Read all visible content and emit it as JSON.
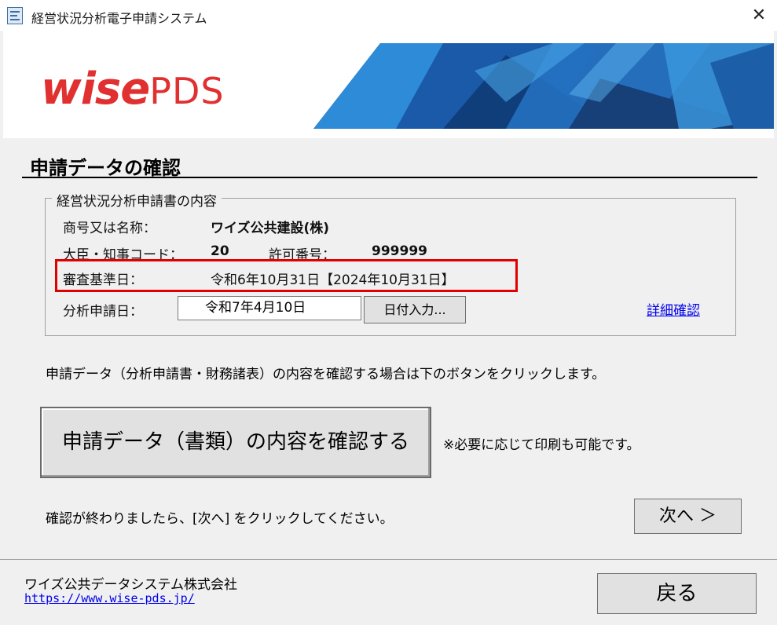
{
  "window": {
    "title": "経営状況分析電子申請システム",
    "close_glyph": "✕"
  },
  "banner": {
    "logo_wise": "wise",
    "logo_pds": "PDS",
    "logo_color": "#e03030"
  },
  "section": {
    "title": "申請データの確認"
  },
  "group": {
    "legend": "経営状況分析申請書の内容",
    "company_label": "商号又は名称：",
    "company_value": "ワイズ公共建設(株)",
    "code_label": "大臣・知事コード：",
    "code_value": "20",
    "permit_label": "許可番号：",
    "permit_value": "999999",
    "review_date_label": "審査基準日：",
    "review_date_value": "令和6年10月31日【2024年10月31日】",
    "apply_date_label": "分析申請日：",
    "apply_date_value": "令和7年4月10日",
    "date_input_button": "日付入力...",
    "detail_link": "詳細確認",
    "highlight_color": "#e00000"
  },
  "main": {
    "instruction": "申請データ（分析申請書・財務諸表）の内容を確認する場合は下のボタンをクリックします。",
    "confirm_button": "申請データ（書類）の内容を確認する",
    "print_note": "※必要に応じて印刷も可能です。",
    "next_instruction": "確認が終わりましたら、[次へ] をクリックしてください。",
    "next_button": "次へ ＞"
  },
  "footer": {
    "company": "ワイズ公共データシステム株式会社",
    "url": "https://www.wise-pds.jp/",
    "back_button": "戻る"
  }
}
